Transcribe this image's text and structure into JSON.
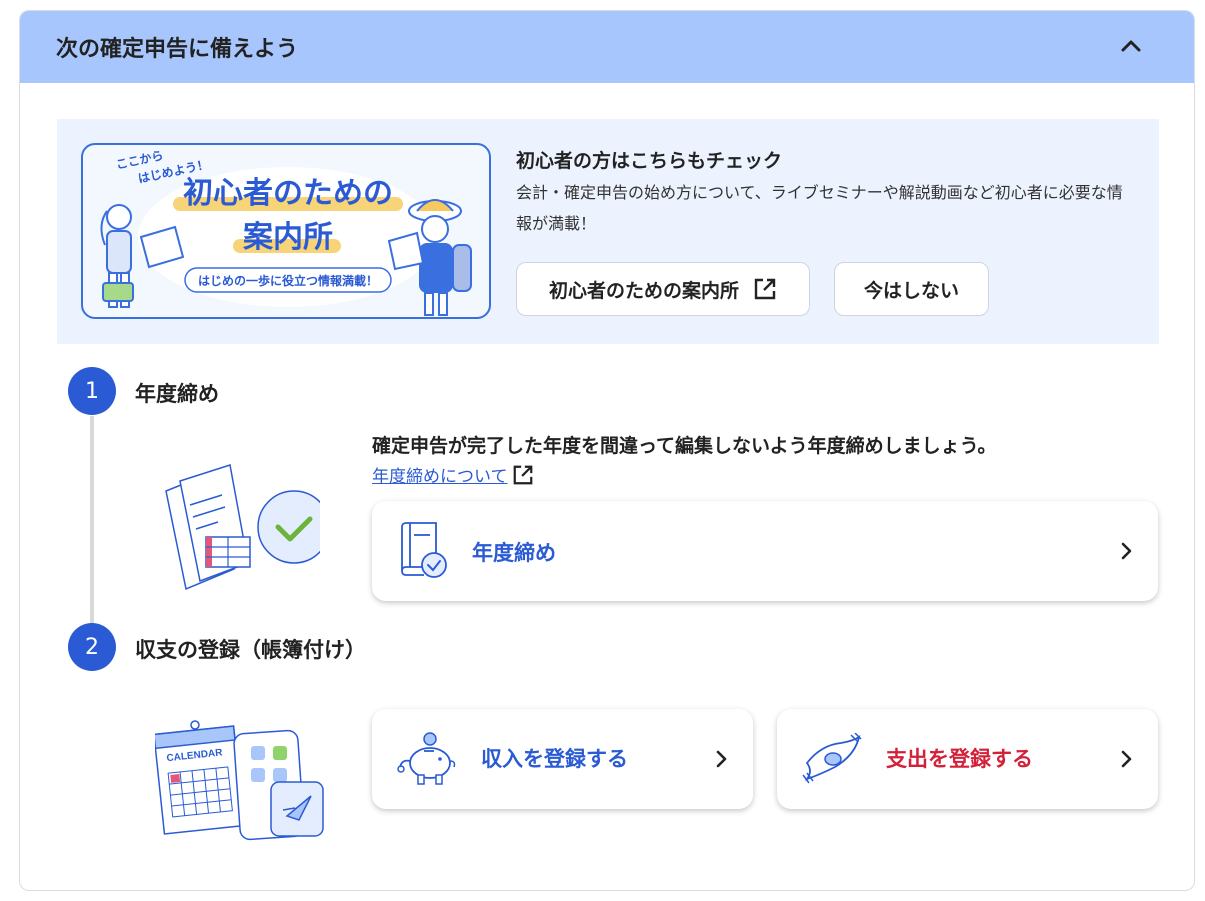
{
  "header": {
    "title": "次の確定申告に備えよう"
  },
  "promo": {
    "banner": {
      "small_text": "ここから はじめよう！",
      "title_line1": "初心者のための",
      "title_line2": "案内所",
      "subtitle": "はじめの一歩に役立つ情報満載！"
    },
    "heading": "初心者の方はこちらもチェック",
    "description": "会計・確定申告の始め方について、ライブセミナーや解説動画など初心者に必要な情報が満載！",
    "guide_button": "初心者のための案内所",
    "dismiss_button": "今はしない"
  },
  "steps": [
    {
      "number": "1",
      "title": "年度締め",
      "description": "確定申告が完了した年度を間違って編集しないよう年度締めしましょう。",
      "link": "年度締めについて",
      "card_label": "年度締め"
    },
    {
      "number": "2",
      "title": "収支の登録（帳簿付け）",
      "income_label": "収入を登録する",
      "expense_label": "支出を登録する",
      "calendar_text": "CALENDAR"
    }
  ],
  "colors": {
    "header_bg": "#a7c6fd",
    "accent_blue": "#2a5bd4",
    "expense_red": "#d4213a",
    "promo_bg": "#ecf3fe"
  }
}
